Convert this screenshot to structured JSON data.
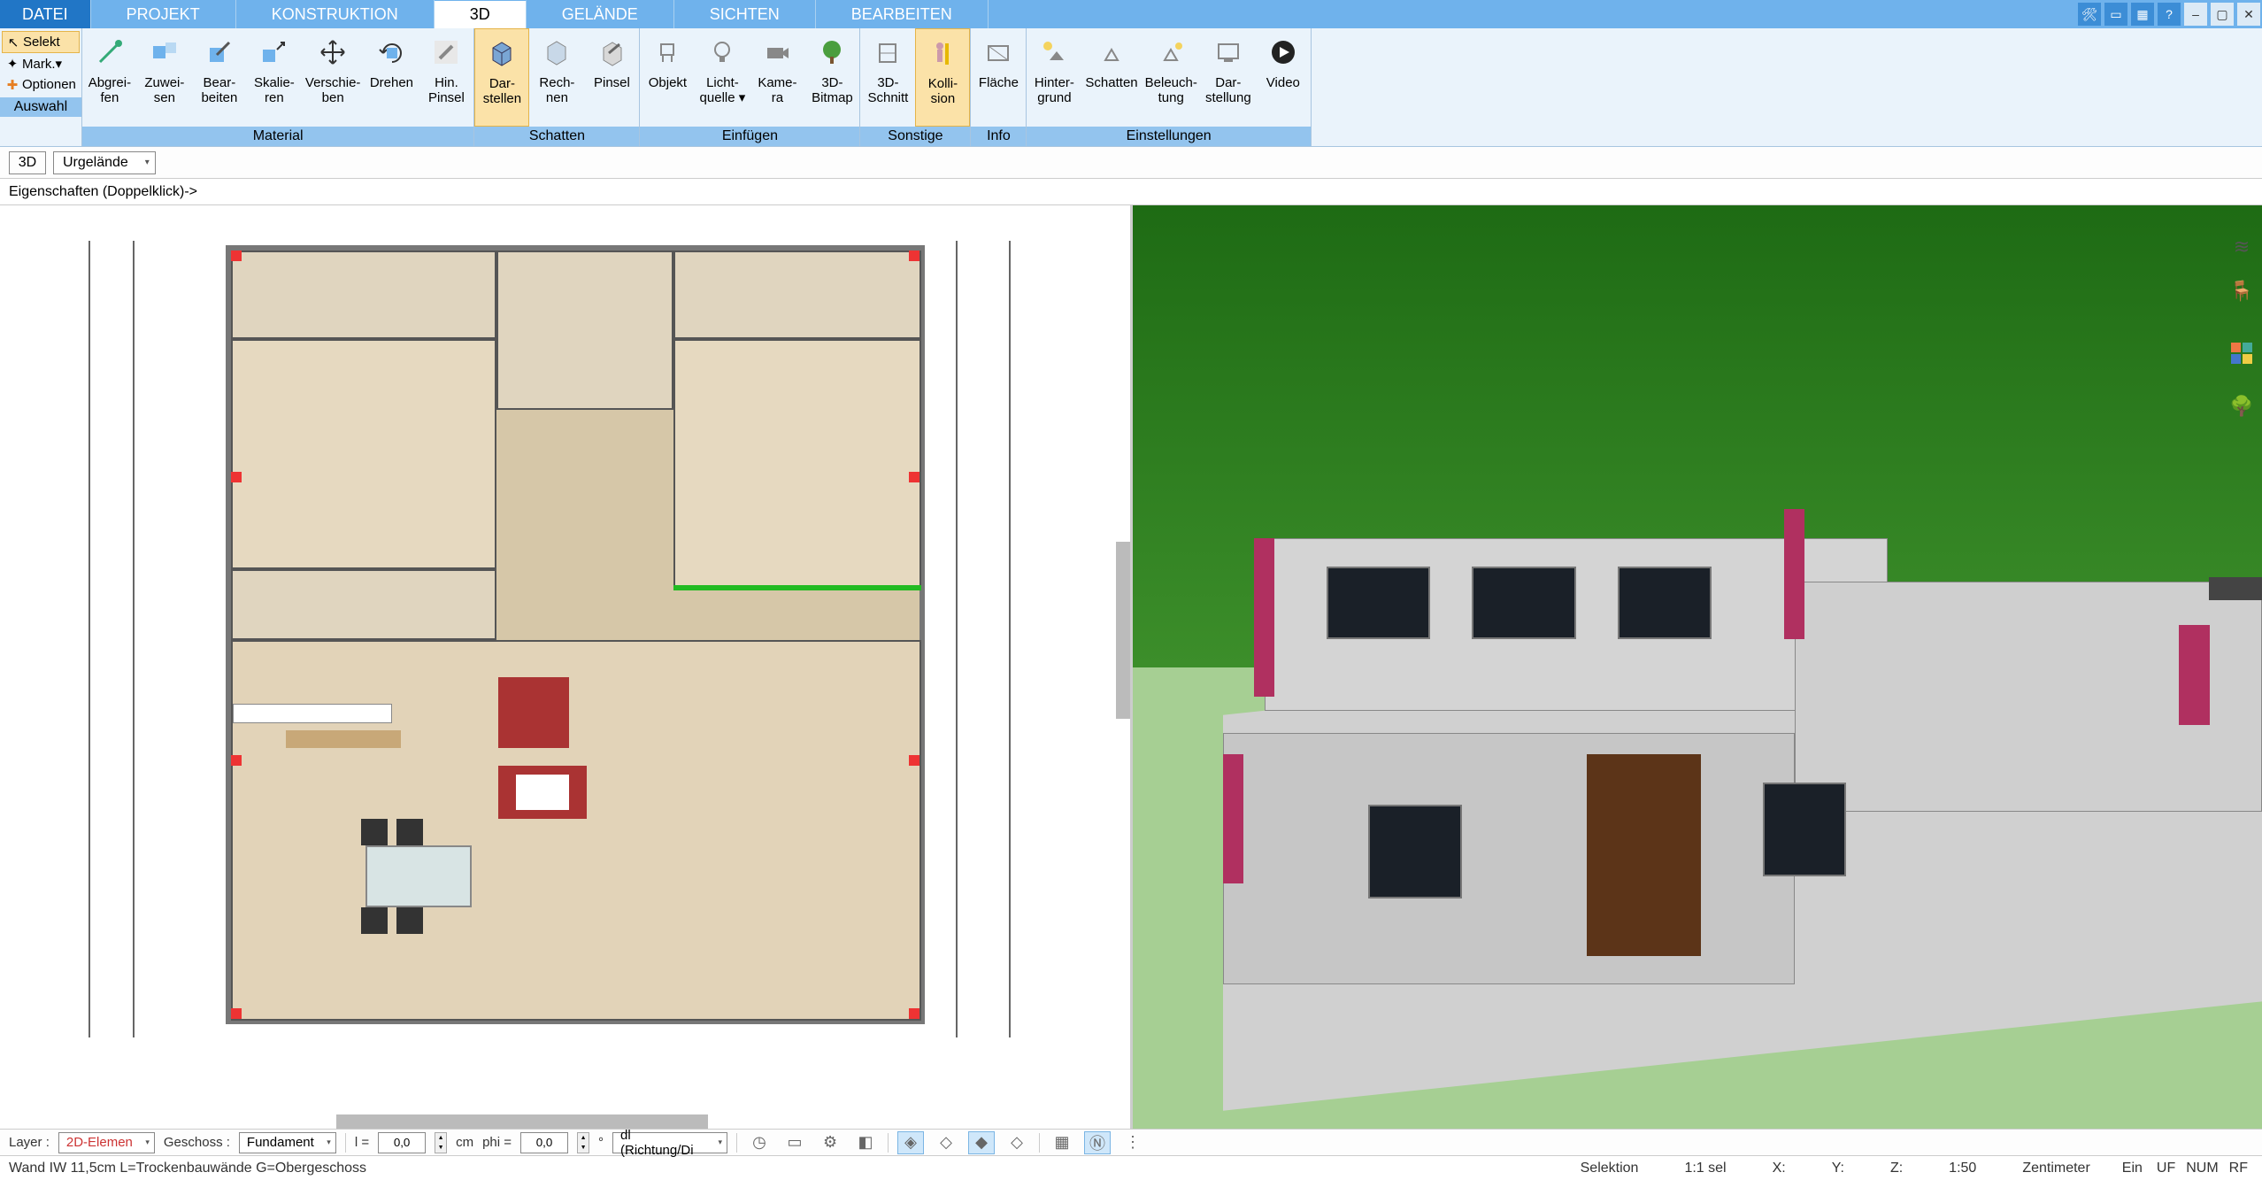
{
  "menu": {
    "tabs": [
      "DATEI",
      "PROJEKT",
      "KONSTRUKTION",
      "3D",
      "GELÄNDE",
      "SICHTEN",
      "BEARBEITEN"
    ],
    "active": 3
  },
  "ribbon": {
    "left": {
      "select": "Selekt",
      "mark": "Mark.",
      "options": "Optionen",
      "group_label": "Auswahl"
    },
    "material": {
      "items": [
        {
          "l1": "Abgrei-",
          "l2": "fen"
        },
        {
          "l1": "Zuwei-",
          "l2": "sen"
        },
        {
          "l1": "Bear-",
          "l2": "beiten"
        },
        {
          "l1": "Skalie-",
          "l2": "ren"
        },
        {
          "l1": "Verschie-",
          "l2": "ben"
        },
        {
          "l1": "Drehen",
          "l2": ""
        },
        {
          "l1": "Hin.",
          "l2": "Pinsel"
        }
      ],
      "label": "Material"
    },
    "schatten": {
      "items": [
        {
          "l1": "Dar-",
          "l2": "stellen",
          "active": true
        },
        {
          "l1": "Rech-",
          "l2": "nen"
        },
        {
          "l1": "Pinsel",
          "l2": ""
        }
      ],
      "label": "Schatten"
    },
    "einfugen": {
      "items": [
        {
          "l1": "Objekt",
          "l2": ""
        },
        {
          "l1": "Licht-",
          "l2": "quelle ▾"
        },
        {
          "l1": "Kame-",
          "l2": "ra"
        },
        {
          "l1": "3D-",
          "l2": "Bitmap"
        }
      ],
      "label": "Einfügen"
    },
    "sonstige": {
      "items": [
        {
          "l1": "3D-",
          "l2": "Schnitt"
        },
        {
          "l1": "Kolli-",
          "l2": "sion",
          "active": true
        }
      ],
      "label": "Sonstige"
    },
    "info": {
      "items": [
        {
          "l1": "Fläche",
          "l2": ""
        }
      ],
      "label": "Info"
    },
    "einstellungen": {
      "items": [
        {
          "l1": "Hinter-",
          "l2": "grund"
        },
        {
          "l1": "Schatten",
          "l2": ""
        },
        {
          "l1": "Beleuch-",
          "l2": "tung"
        },
        {
          "l1": "Dar-",
          "l2": "stellung"
        },
        {
          "l1": "Video",
          "l2": ""
        }
      ],
      "label": "Einstellungen"
    }
  },
  "secondary": {
    "view_mode": "3D",
    "terrain": "Urgelände"
  },
  "properties_hint": "Eigenschaften (Doppelklick)->",
  "bottom": {
    "layer_lbl": "Layer :",
    "layer_val": "2D-Elemen",
    "floor_lbl": "Geschoss :",
    "floor_val": "Fundament",
    "l_lbl": "l =",
    "l_val": "0,0",
    "l_unit": "cm",
    "phi_lbl": "phi =",
    "phi_val": "0,0",
    "phi_unit": "°",
    "dir": "dl (Richtung/Di"
  },
  "status": {
    "left": "Wand IW 11,5cm L=Trockenbauwände G=Obergeschoss",
    "selection": "Selektion",
    "sel_count": "1:1 sel",
    "x": "X:",
    "y": "Y:",
    "z": "Z:",
    "scale": "1:50",
    "unit": "Zentimeter",
    "ein": "Ein",
    "uf": "UF",
    "num": "NUM",
    "rf": "RF"
  }
}
